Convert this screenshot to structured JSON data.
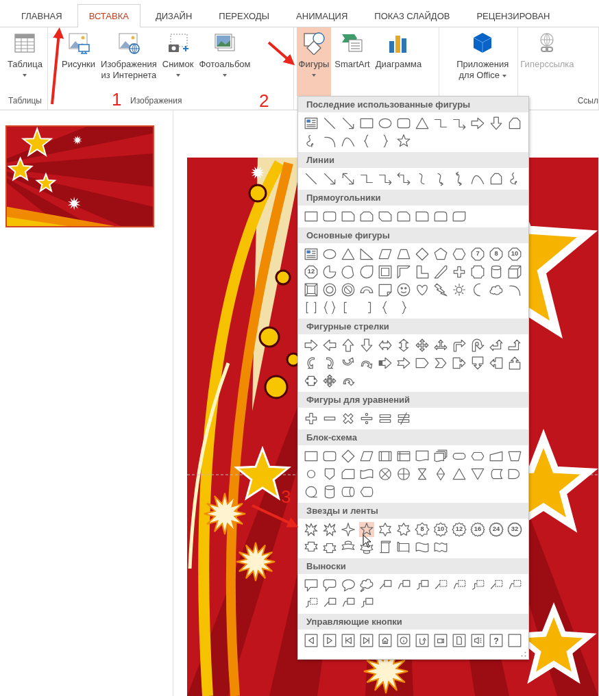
{
  "tabs": [
    {
      "label": "ГЛАВНАЯ",
      "selected": false
    },
    {
      "label": "ВСТАВКА",
      "selected": true
    },
    {
      "label": "ДИЗАЙН",
      "selected": false
    },
    {
      "label": "ПЕРЕХОДЫ",
      "selected": false
    },
    {
      "label": "АНИМАЦИЯ",
      "selected": false
    },
    {
      "label": "ПОКАЗ СЛАЙДОВ",
      "selected": false
    },
    {
      "label": "РЕЦЕНЗИРОВАН",
      "selected": false
    }
  ],
  "ribbon": {
    "groups": [
      {
        "label": "Таблицы",
        "buttons": [
          {
            "lines": [
              "Таблица"
            ],
            "dropdown": true,
            "pressed": false,
            "disabled": false
          }
        ]
      },
      {
        "label": "Изображения",
        "buttons": [
          {
            "lines": [
              "Рисунки"
            ],
            "dropdown": false,
            "pressed": false,
            "disabled": false
          },
          {
            "lines": [
              "Изображения",
              "из Интернета"
            ],
            "dropdown": false,
            "pressed": false,
            "disabled": false
          },
          {
            "lines": [
              "Снимок"
            ],
            "dropdown": true,
            "pressed": false,
            "disabled": false
          },
          {
            "lines": [
              "Фотоальбом"
            ],
            "dropdown": true,
            "pressed": false,
            "disabled": false
          }
        ]
      },
      {
        "buttons": [
          {
            "lines": [
              "Фигуры"
            ],
            "dropdown": true,
            "pressed": true,
            "disabled": false
          },
          {
            "lines": [
              "SmartArt"
            ],
            "dropdown": false,
            "pressed": false,
            "disabled": false
          },
          {
            "lines": [
              "Диаграмма"
            ],
            "dropdown": false,
            "pressed": false,
            "disabled": false
          }
        ]
      },
      {
        "buttons": [
          {
            "lines": [
              "Приложения",
              "для Office"
            ],
            "dropdown": true,
            "pressed": false,
            "disabled": false
          }
        ]
      },
      {
        "label": "Ссыл",
        "buttons": [
          {
            "lines": [
              "Гиперссылка"
            ],
            "dropdown": false,
            "pressed": false,
            "disabled": true
          }
        ]
      }
    ]
  },
  "slides": {
    "thumbnails": [
      {
        "selected": true
      }
    ]
  },
  "shapes_menu": {
    "sections": [
      {
        "title": "Последние использованные фигуры",
        "shapes": [
          {
            "kind": "textbox"
          },
          {
            "kind": "line"
          },
          {
            "kind": "arrowline"
          },
          {
            "kind": "rect"
          },
          {
            "kind": "ellipse"
          },
          {
            "kind": "roundrect"
          },
          {
            "kind": "triangle"
          },
          {
            "kind": "elbow"
          },
          {
            "kind": "elbowarrow"
          },
          {
            "kind": "right"
          },
          {
            "kind": "down"
          },
          {
            "kind": "freeform"
          },
          {
            "kind": "scribble"
          },
          {
            "kind": "arc"
          },
          {
            "kind": "wave"
          },
          {
            "kind": "bracel"
          },
          {
            "kind": "bracer"
          },
          {
            "kind": "star5"
          }
        ]
      },
      {
        "title": "Линии",
        "shapes": [
          {
            "kind": "line"
          },
          {
            "kind": "arrowline"
          },
          {
            "kind": "dblarrow"
          },
          {
            "kind": "elbow"
          },
          {
            "kind": "elbowarrow"
          },
          {
            "kind": "elbowdbl"
          },
          {
            "kind": "curve"
          },
          {
            "kind": "curvearrow"
          },
          {
            "kind": "curvedbl"
          },
          {
            "kind": "wave"
          },
          {
            "kind": "freeform"
          },
          {
            "kind": "scribble"
          }
        ]
      },
      {
        "title": "Прямоугольники",
        "shapes": [
          {
            "kind": "rect"
          },
          {
            "kind": "roundrect"
          },
          {
            "kind": "snip1"
          },
          {
            "kind": "snip2"
          },
          {
            "kind": "snip3"
          },
          {
            "kind": "sniprnd"
          },
          {
            "kind": "round1"
          },
          {
            "kind": "round2"
          },
          {
            "kind": "round3"
          }
        ]
      },
      {
        "title": "Основные фигуры",
        "shapes": [
          {
            "kind": "textbox"
          },
          {
            "kind": "ellipse"
          },
          {
            "kind": "triangle"
          },
          {
            "kind": "rtriangle"
          },
          {
            "kind": "parallelogram"
          },
          {
            "kind": "trapezoid"
          },
          {
            "kind": "diamond"
          },
          {
            "kind": "pentagon"
          },
          {
            "kind": "hexagon"
          },
          {
            "kind": "numpoly",
            "label": "7"
          },
          {
            "kind": "numpoly",
            "label": "8"
          },
          {
            "kind": "numpoly",
            "label": "10"
          },
          {
            "kind": "numpoly",
            "label": "12"
          },
          {
            "kind": "pie"
          },
          {
            "kind": "chord"
          },
          {
            "kind": "teardrop"
          },
          {
            "kind": "frame"
          },
          {
            "kind": "halfframe"
          },
          {
            "kind": "lshape"
          },
          {
            "kind": "diagstripe"
          },
          {
            "kind": "cross"
          },
          {
            "kind": "plaque"
          },
          {
            "kind": "can"
          },
          {
            "kind": "cube"
          },
          {
            "kind": "bevel"
          },
          {
            "kind": "donut"
          },
          {
            "kind": "nosymbol"
          },
          {
            "kind": "blockarc"
          },
          {
            "kind": "folded"
          },
          {
            "kind": "smiley"
          },
          {
            "kind": "heart"
          },
          {
            "kind": "lightning"
          },
          {
            "kind": "sun"
          },
          {
            "kind": "moon"
          },
          {
            "kind": "cloud"
          },
          {
            "kind": "arc"
          },
          {
            "kind": "bracketpair"
          },
          {
            "kind": "bracepair"
          },
          {
            "kind": "bracketl"
          },
          {
            "kind": "bracketr"
          },
          {
            "kind": "bracel"
          },
          {
            "kind": "bracer"
          }
        ]
      },
      {
        "title": "Фигурные стрелки",
        "shapes": [
          {
            "kind": "right"
          },
          {
            "kind": "left"
          },
          {
            "kind": "up"
          },
          {
            "kind": "down"
          },
          {
            "kind": "leftright"
          },
          {
            "kind": "updown"
          },
          {
            "kind": "quad"
          },
          {
            "kind": "lru"
          },
          {
            "kind": "bent"
          },
          {
            "kind": "uturn"
          },
          {
            "kind": "leftup"
          },
          {
            "kind": "bentup"
          },
          {
            "kind": "curvedright"
          },
          {
            "kind": "curvedleft"
          },
          {
            "kind": "curvedup"
          },
          {
            "kind": "curveddown"
          },
          {
            "kind": "striped"
          },
          {
            "kind": "notched"
          },
          {
            "kind": "homeplate"
          },
          {
            "kind": "chevron"
          },
          {
            "kind": "rightcallout"
          },
          {
            "kind": "downcallout"
          },
          {
            "kind": "leftcallout"
          },
          {
            "kind": "upcallout"
          },
          {
            "kind": "lrcallout"
          },
          {
            "kind": "quadcallout"
          },
          {
            "kind": "circular"
          }
        ]
      },
      {
        "title": "Фигуры для уравнений",
        "shapes": [
          {
            "kind": "plus"
          },
          {
            "kind": "minus"
          },
          {
            "kind": "multiply"
          },
          {
            "kind": "divide"
          },
          {
            "kind": "equal"
          },
          {
            "kind": "notequal"
          }
        ]
      },
      {
        "title": "Блок-схема",
        "shapes": [
          {
            "kind": "rect"
          },
          {
            "kind": "roundrect"
          },
          {
            "kind": "diamond"
          },
          {
            "kind": "parallelogram"
          },
          {
            "kind": "predefined"
          },
          {
            "kind": "internal"
          },
          {
            "kind": "document"
          },
          {
            "kind": "multidoc"
          },
          {
            "kind": "terminator"
          },
          {
            "kind": "preparation"
          },
          {
            "kind": "manualinput"
          },
          {
            "kind": "manualop"
          },
          {
            "kind": "connector"
          },
          {
            "kind": "offpage"
          },
          {
            "kind": "card"
          },
          {
            "kind": "tape"
          },
          {
            "kind": "sumjunction"
          },
          {
            "kind": "or"
          },
          {
            "kind": "collate"
          },
          {
            "kind": "sort"
          },
          {
            "kind": "triangle"
          },
          {
            "kind": "merge"
          },
          {
            "kind": "storeddata"
          },
          {
            "kind": "delay"
          },
          {
            "kind": "seqaccess"
          },
          {
            "kind": "can"
          },
          {
            "kind": "directaccess"
          },
          {
            "kind": "display"
          }
        ]
      },
      {
        "title": "Звезды и ленты",
        "shapes": [
          {
            "kind": "explosion1",
            "selected": false
          },
          {
            "kind": "explosion2",
            "selected": false
          },
          {
            "kind": "star4",
            "selected": false
          },
          {
            "kind": "star5",
            "selected": true
          },
          {
            "kind": "star6",
            "selected": false
          },
          {
            "kind": "star7",
            "selected": false
          },
          {
            "kind": "seal8",
            "label": "8",
            "selected": false
          },
          {
            "kind": "seal10",
            "label": "10",
            "selected": false
          },
          {
            "kind": "seal12",
            "label": "12",
            "selected": false
          },
          {
            "kind": "seal16",
            "label": "16",
            "selected": false
          },
          {
            "kind": "seal24",
            "label": "24",
            "selected": false
          },
          {
            "kind": "seal32",
            "label": "32",
            "selected": false
          },
          {
            "kind": "ribbonup",
            "selected": false
          },
          {
            "kind": "ribbondown",
            "selected": false
          },
          {
            "kind": "cribbonup",
            "selected": false
          },
          {
            "kind": "cribbondown",
            "selected": false
          },
          {
            "kind": "vscroll",
            "selected": false
          },
          {
            "kind": "hscroll",
            "selected": false
          },
          {
            "kind": "wavebanner",
            "selected": false
          },
          {
            "kind": "doublewave",
            "selected": false
          }
        ]
      },
      {
        "title": "Выноски",
        "shapes": [
          {
            "kind": "rectcallout"
          },
          {
            "kind": "roundcallout"
          },
          {
            "kind": "ovalcallout"
          },
          {
            "kind": "cloudcallout"
          },
          {
            "kind": "linecallout1"
          },
          {
            "kind": "linecallout2"
          },
          {
            "kind": "linecallout3"
          },
          {
            "kind": "dashcallout1"
          },
          {
            "kind": "dashcallout2"
          },
          {
            "kind": "dashcallout3"
          },
          {
            "kind": "dashcallout1"
          },
          {
            "kind": "dashcallout2"
          },
          {
            "kind": "dashcallout3"
          },
          {
            "kind": "linecallout1"
          },
          {
            "kind": "linecallout2"
          },
          {
            "kind": "linecallout3"
          }
        ]
      },
      {
        "title": "Управляющие кнопки",
        "shapes": [
          {
            "kind": "actback"
          },
          {
            "kind": "actfwd"
          },
          {
            "kind": "actbegin"
          },
          {
            "kind": "actend"
          },
          {
            "kind": "acthome"
          },
          {
            "kind": "actinfo"
          },
          {
            "kind": "actreturn"
          },
          {
            "kind": "actmovie"
          },
          {
            "kind": "actdoc"
          },
          {
            "kind": "actsound"
          },
          {
            "kind": "acthelp",
            "label": "?"
          },
          {
            "kind": "actcustom"
          }
        ]
      }
    ]
  },
  "annotations": [
    {
      "label": "1"
    },
    {
      "label": "2"
    },
    {
      "label": "3"
    }
  ]
}
